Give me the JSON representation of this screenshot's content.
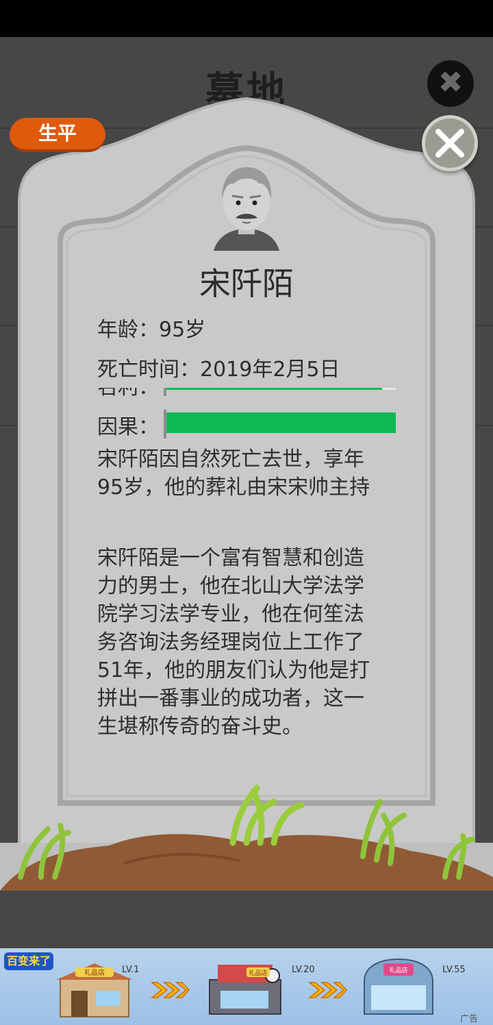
{
  "background": {
    "title": "墓地",
    "close_icon": "close-icon"
  },
  "tab": {
    "label": "生平"
  },
  "close_button": {
    "icon": "close-icon"
  },
  "tombstone": {
    "portrait_icon": "old-man-portrait-icon",
    "name": "宋阡陌",
    "age": "年龄：95岁",
    "death_time": "死亡时间：2019年2月5日",
    "partial_label": "名利：",
    "partial_bar_level": 0.94,
    "karma_label": "因果：",
    "karma_level": 1.0,
    "bar_color": "#0fba53",
    "death_text": "宋阡陌因自然死亡去世，享年95岁，他的葬礼由宋宋帅主持",
    "bio_text": "宋阡陌是一个富有智慧和创造力的男士，他在北山大学法学院学习法学专业，他在何笙法务咨询法务经理岗位上工作了51年，他的朋友们认为他是打拼出一番事业的成功者，这一生堪称传奇的奋斗史。"
  },
  "ad": {
    "logo": "百变来了",
    "shop_label": "礼品店",
    "levels": [
      "LV.1",
      "LV.20",
      "LV.55"
    ],
    "tag": "广告"
  },
  "colors": {
    "accent_orange": "#e05a0c",
    "stone": "#c9c9c9",
    "background": "#474747"
  }
}
